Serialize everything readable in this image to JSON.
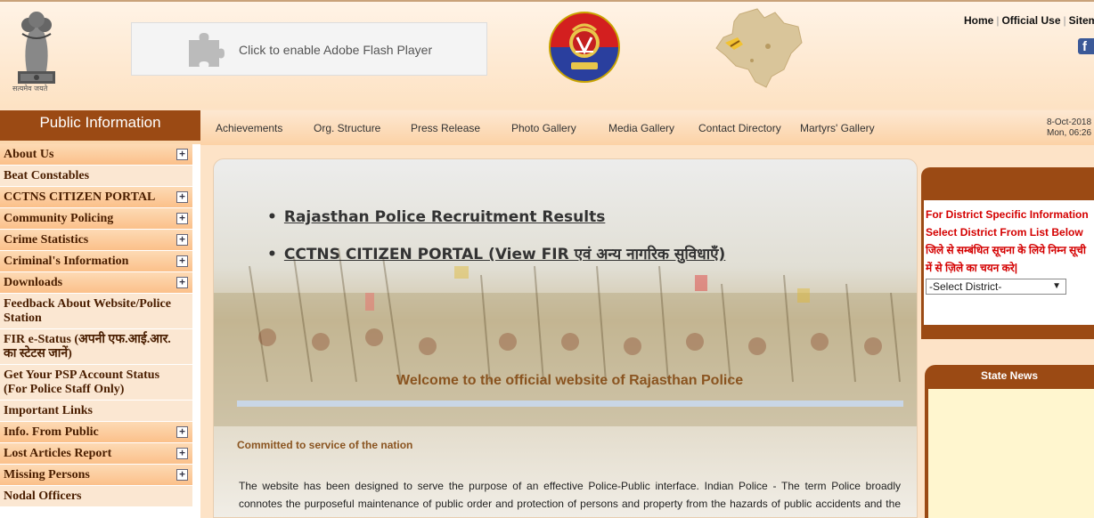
{
  "header": {
    "emblem_caption": "सत्यमेव जयते",
    "flash_text": "Click to enable Adobe Flash Player",
    "top_links": [
      "Home",
      "Official Use",
      "Sitem"
    ],
    "facebook_label": "f"
  },
  "sidebar": {
    "title": "Public Information",
    "items": [
      {
        "label": "About Us",
        "expandable": true
      },
      {
        "label": "Beat Constables",
        "expandable": false
      },
      {
        "label": "CCTNS CITIZEN PORTAL",
        "expandable": true
      },
      {
        "label": "Community Policing",
        "expandable": true
      },
      {
        "label": "Crime Statistics",
        "expandable": true
      },
      {
        "label": "Criminal's Information",
        "expandable": true
      },
      {
        "label": "Downloads",
        "expandable": true
      },
      {
        "label": "Feedback About Website/Police Station",
        "expandable": false
      },
      {
        "label": "FIR e-Status (अपनी एफ.आई.आर. का स्टेटस जानें)",
        "expandable": false
      },
      {
        "label": "Get Your PSP Account Status (For Police Staff Only)",
        "expandable": false
      },
      {
        "label": "Important Links",
        "expandable": false
      },
      {
        "label": "Info. From Public",
        "expandable": true
      },
      {
        "label": "Lost Articles Report",
        "expandable": true
      },
      {
        "label": "Missing Persons",
        "expandable": true
      },
      {
        "label": "Nodal Officers",
        "expandable": false
      }
    ],
    "expand_symbol": "+"
  },
  "nav": {
    "items": [
      "Achievements",
      "Org. Structure",
      "Press Release",
      "Photo Gallery",
      "Media Gallery",
      "Contact Directory",
      "Martyrs' Gallery"
    ],
    "date": "8-Oct-2018",
    "time": "Mon, 06:26"
  },
  "main": {
    "links": [
      "Rajasthan Police Recruitment Results",
      "CCTNS CITIZEN PORTAL (View FIR एवं अन्य नागरिक सुविधाएँ)"
    ],
    "welcome": "Welcome to the official website of Rajasthan Police",
    "tagline": "Committed to service of the nation",
    "intro": "The website has been designed to serve the purpose of an effective Police-Public interface. Indian Police - The term Police broadly connotes the purposeful maintenance of public order and protection of persons and property from the hazards of public accidents and the commission of unlawful acts. With the advent of independence in August 1947, the 562 princely States of India were gradually integrated"
  },
  "district": {
    "info_en": "For District Specific Information Select District From List Below",
    "info_hi": "जिले से सम्बंधित सूचना के लिये निम्न सूची में से ज़िले का चयन करे|",
    "select_value": "-Select District-",
    "select_arrow": "▼"
  },
  "state_news": {
    "title": "State News"
  },
  "colors": {
    "sidebar_title_bg": "#9b4a14",
    "district_text": "#d40000",
    "welcome_text": "#8a5420"
  }
}
